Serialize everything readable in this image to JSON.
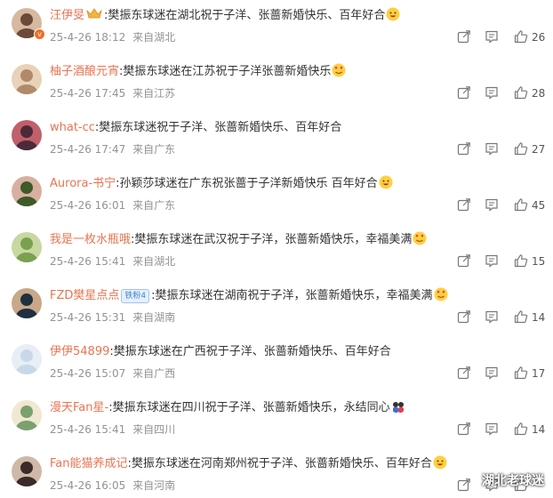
{
  "comments": [
    {
      "user": "汪伊旻",
      "text": ":樊振东球迷在湖北祝于子洋、张蔷新婚快乐、百年好合",
      "time": "25-4-26 18:12",
      "loc": "来自湖北",
      "likes": "26",
      "emoji": "smile",
      "crown": true,
      "vbadge": true
    },
    {
      "user": "柚子酒酿元宵",
      "text": ":樊振东球迷在江苏祝于子洋张蔷新婚快乐",
      "time": "25-4-26 17:45",
      "loc": "来自江苏",
      "likes": "28",
      "emoji": "love"
    },
    {
      "user": "what-cc",
      "text": ":樊振东球迷祝于子洋、张蔷新婚快乐、百年好合",
      "time": "25-4-26 17:47",
      "loc": "来自广东",
      "likes": "27",
      "emoji": ""
    },
    {
      "user": "Aurora-书宁",
      "text": ":孙颖莎球迷在广东祝张蔷于子洋新婚快乐 百年好合",
      "time": "25-4-26 16:01",
      "loc": "来自广东",
      "likes": "45",
      "emoji": "smile"
    },
    {
      "user": "我是一枚水瓶哦",
      "text": ":樊振东球迷在武汉祝于子洋，张蔷新婚快乐，幸福美满",
      "time": "25-4-26 15:41",
      "loc": "来自湖北",
      "likes": "15",
      "emoji": "love"
    },
    {
      "user": "FZD樊星点点",
      "badge": "铁粉4",
      "text": ":樊振东球迷在湖南祝于子洋，张蔷新婚快乐，幸福美满",
      "time": "25-4-26 15:31",
      "loc": "来自湖南",
      "likes": "14",
      "emoji": "love"
    },
    {
      "user": "伊伊54899",
      "text": ":樊振东球迷在广西祝于子洋、张蔷新婚快乐、百年好合",
      "time": "25-4-26 15:07",
      "loc": "来自广西",
      "likes": "17",
      "emoji": ""
    },
    {
      "user": "漫天Fan星-",
      "text": ":樊振东球迷在四川祝于子洋、张蔷新婚快乐，永结同心",
      "time": "25-4-26 15:41",
      "loc": "来自四川",
      "likes": "14",
      "emoji": "couple"
    },
    {
      "user": "Fan能猫养成记",
      "text": ":樊振东球迷在河南郑州祝于子洋、张蔷新婚快乐、百年好合",
      "time": "25-4-26 16:05",
      "loc": "来自河南",
      "likes": "",
      "emoji": "smile"
    }
  ],
  "watermark": "湖北老球迷",
  "colors": {
    "username": "#eb7350",
    "meta": "#939393",
    "badge": "#f26d24"
  },
  "icons": [
    "share-icon",
    "comment-icon",
    "like-icon"
  ]
}
